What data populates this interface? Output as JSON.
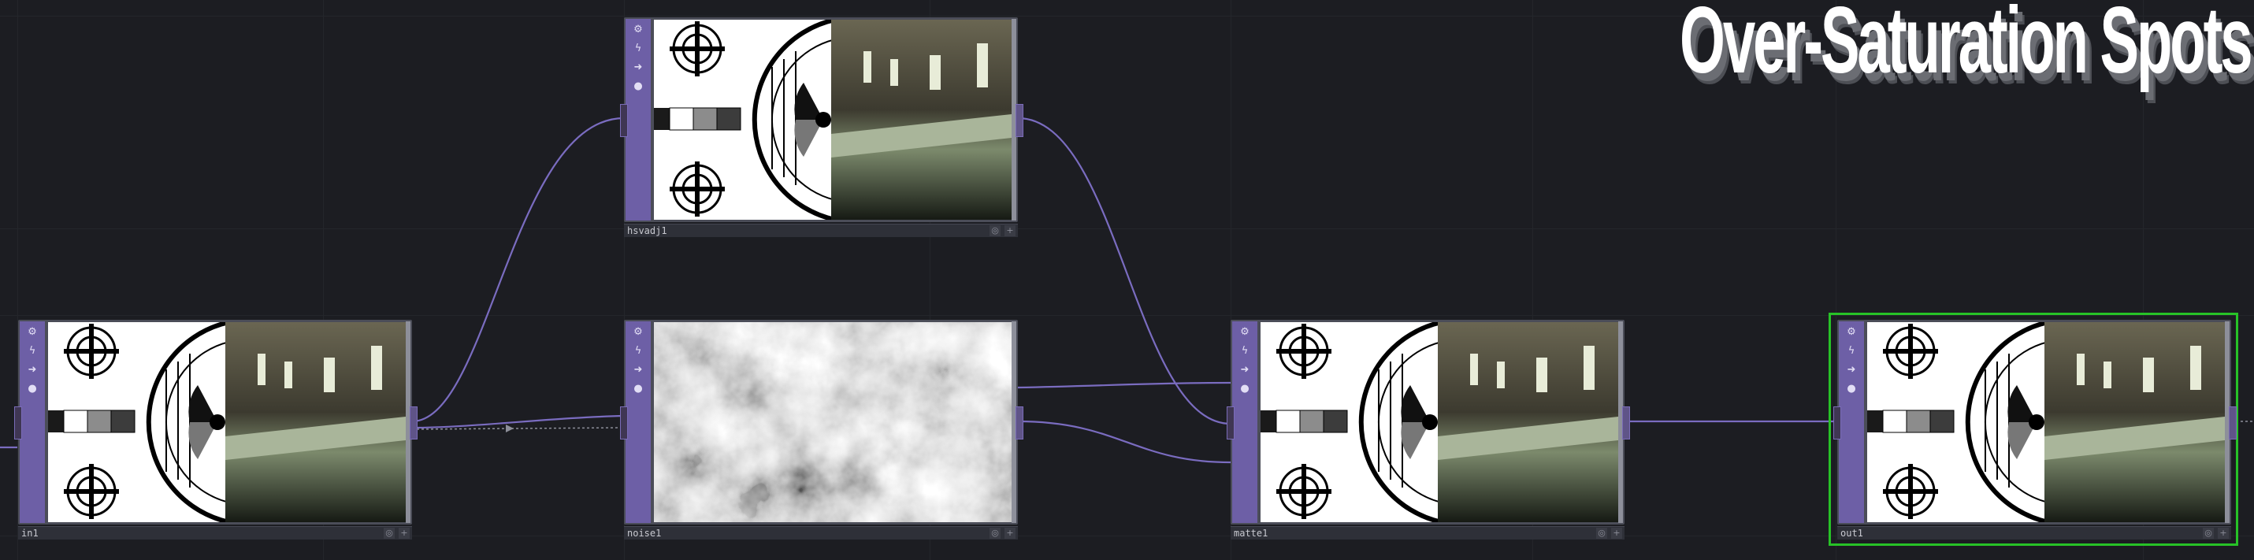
{
  "title": "Over-Saturation Spots",
  "nodes": [
    {
      "id": "in1",
      "label": "in1",
      "kind": "testpattern"
    },
    {
      "id": "hsvadj1",
      "label": "hsvadj1",
      "kind": "testpattern"
    },
    {
      "id": "noise1",
      "label": "noise1",
      "kind": "noise"
    },
    {
      "id": "matte1",
      "label": "matte1",
      "kind": "testpattern"
    },
    {
      "id": "out1",
      "label": "out1",
      "kind": "testpattern",
      "selected": true
    }
  ],
  "node_icons": [
    "gear-icon",
    "lightning-icon",
    "arrow-icon",
    "drop-icon"
  ],
  "testpattern": {
    "tl": "20",
    "tr": "30",
    "bl": "40",
    "br": "50"
  },
  "colors": {
    "background": "#1c1d22",
    "node_strip": "#6d5fa6",
    "wire": "#7a6cc0",
    "selection": "#27c227"
  }
}
